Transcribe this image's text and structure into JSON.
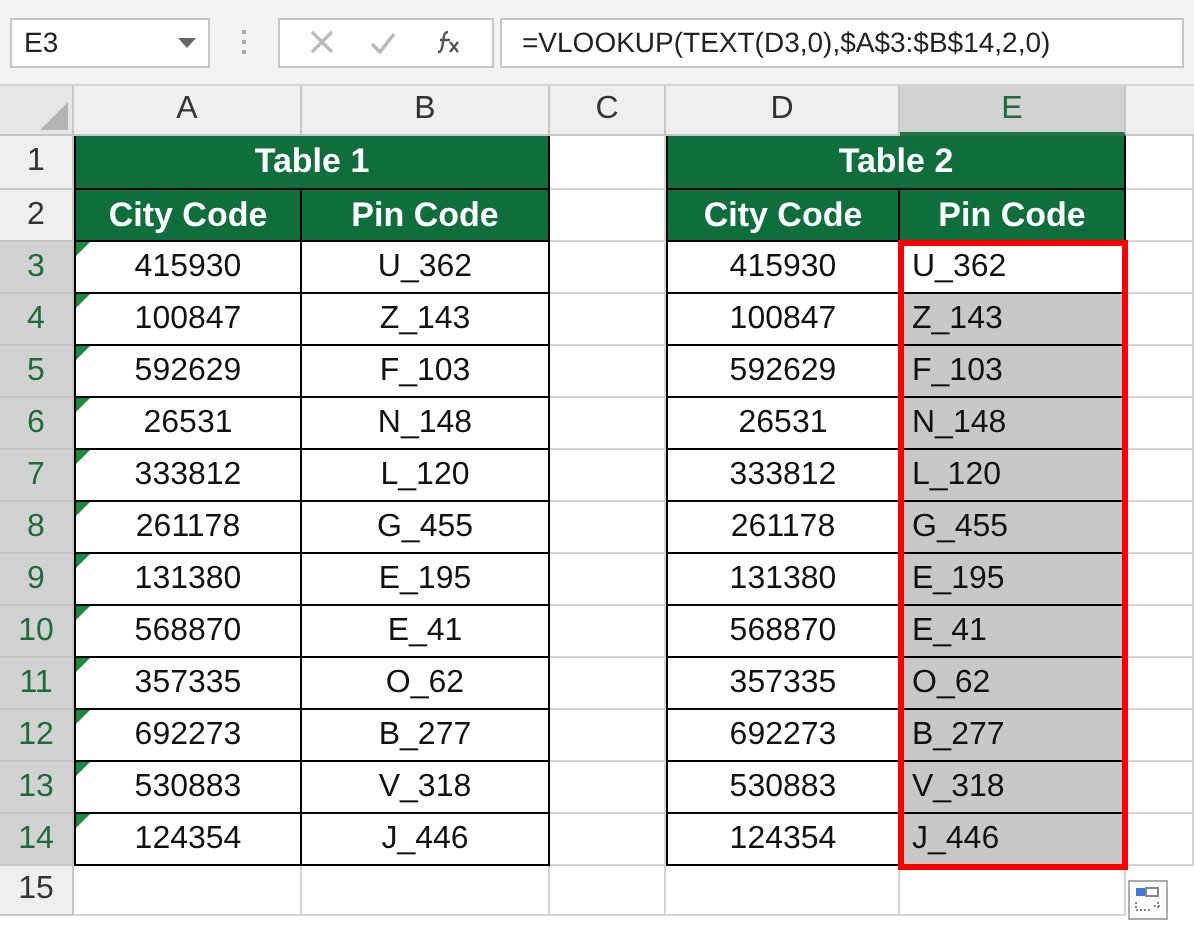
{
  "name_box": "E3",
  "formula": "=VLOOKUP(TEXT(D3,0),$A$3:$B$14,2,0)",
  "columns": [
    {
      "label": "A",
      "selected": false
    },
    {
      "label": "B",
      "selected": false
    },
    {
      "label": "C",
      "selected": false
    },
    {
      "label": "D",
      "selected": false
    },
    {
      "label": "E",
      "selected": true
    }
  ],
  "rows": [
    {
      "label": "1",
      "selected": false
    },
    {
      "label": "2",
      "selected": false
    },
    {
      "label": "3",
      "selected": true
    },
    {
      "label": "4",
      "selected": true
    },
    {
      "label": "5",
      "selected": true
    },
    {
      "label": "6",
      "selected": true
    },
    {
      "label": "7",
      "selected": true
    },
    {
      "label": "8",
      "selected": true
    },
    {
      "label": "9",
      "selected": true
    },
    {
      "label": "10",
      "selected": true
    },
    {
      "label": "11",
      "selected": true
    },
    {
      "label": "12",
      "selected": true
    },
    {
      "label": "13",
      "selected": true
    },
    {
      "label": "14",
      "selected": true
    },
    {
      "label": "15",
      "selected": false
    }
  ],
  "table_1": {
    "title": "Table 1",
    "headers": [
      "City Code",
      "Pin Code"
    ],
    "rows": [
      {
        "city_code": "415930",
        "pin_code": "U_362",
        "error_flag": true
      },
      {
        "city_code": "100847",
        "pin_code": "Z_143",
        "error_flag": true
      },
      {
        "city_code": "592629",
        "pin_code": "F_103",
        "error_flag": true
      },
      {
        "city_code": "26531",
        "pin_code": "N_148",
        "error_flag": true
      },
      {
        "city_code": "333812",
        "pin_code": "L_120",
        "error_flag": true
      },
      {
        "city_code": "261178",
        "pin_code": "G_455",
        "error_flag": true
      },
      {
        "city_code": "131380",
        "pin_code": "E_195",
        "error_flag": true
      },
      {
        "city_code": "568870",
        "pin_code": "E_41",
        "error_flag": true
      },
      {
        "city_code": "357335",
        "pin_code": "O_62",
        "error_flag": true
      },
      {
        "city_code": "692273",
        "pin_code": "B_277",
        "error_flag": true
      },
      {
        "city_code": "530883",
        "pin_code": "V_318",
        "error_flag": true
      },
      {
        "city_code": "124354",
        "pin_code": "J_446",
        "error_flag": true
      }
    ]
  },
  "table_2": {
    "title": "Table 2",
    "headers": [
      "City Code",
      "Pin Code"
    ],
    "rows": [
      {
        "city_code": "415930",
        "pin_code": "U_362",
        "active": true
      },
      {
        "city_code": "100847",
        "pin_code": "Z_143",
        "active": false
      },
      {
        "city_code": "592629",
        "pin_code": "F_103",
        "active": false
      },
      {
        "city_code": "26531",
        "pin_code": "N_148",
        "active": false
      },
      {
        "city_code": "333812",
        "pin_code": "L_120",
        "active": false
      },
      {
        "city_code": "261178",
        "pin_code": "G_455",
        "active": false
      },
      {
        "city_code": "131380",
        "pin_code": "E_195",
        "active": false
      },
      {
        "city_code": "568870",
        "pin_code": "E_41",
        "active": false
      },
      {
        "city_code": "357335",
        "pin_code": "O_62",
        "active": false
      },
      {
        "city_code": "692273",
        "pin_code": "B_277",
        "active": false
      },
      {
        "city_code": "530883",
        "pin_code": "V_318",
        "active": false
      },
      {
        "city_code": "124354",
        "pin_code": "J_446",
        "active": false
      }
    ]
  }
}
